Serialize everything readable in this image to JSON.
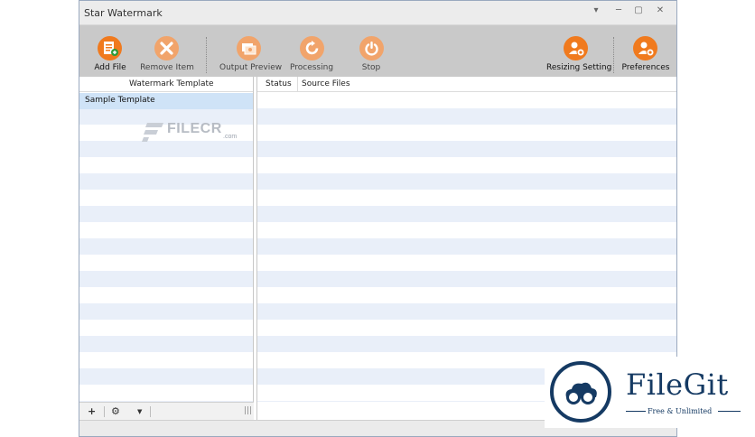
{
  "window": {
    "title": "Star Watermark"
  },
  "toolbar": {
    "add_file": "Add File",
    "remove_item": "Remove Item",
    "output_preview": "Output Preview",
    "processing": "Processing",
    "stop": "Stop",
    "resizing_setting": "Resizing Setting",
    "preferences": "Preferences"
  },
  "left_panel": {
    "header": "Watermark Template",
    "items": [
      "Sample Template"
    ]
  },
  "right_panel": {
    "columns": [
      "Status",
      "Source Files"
    ]
  },
  "watermark_overlay": {
    "brand": "FILECR",
    "suffix": ".com"
  },
  "filegit_logo": {
    "title": "FileGit",
    "subtitle": "Free & Unlimited"
  },
  "colors": {
    "accent_orange": "#f07a1e",
    "selection": "#cfe3f7",
    "stripe": "#e9eff9",
    "brand_navy": "#153a63"
  }
}
